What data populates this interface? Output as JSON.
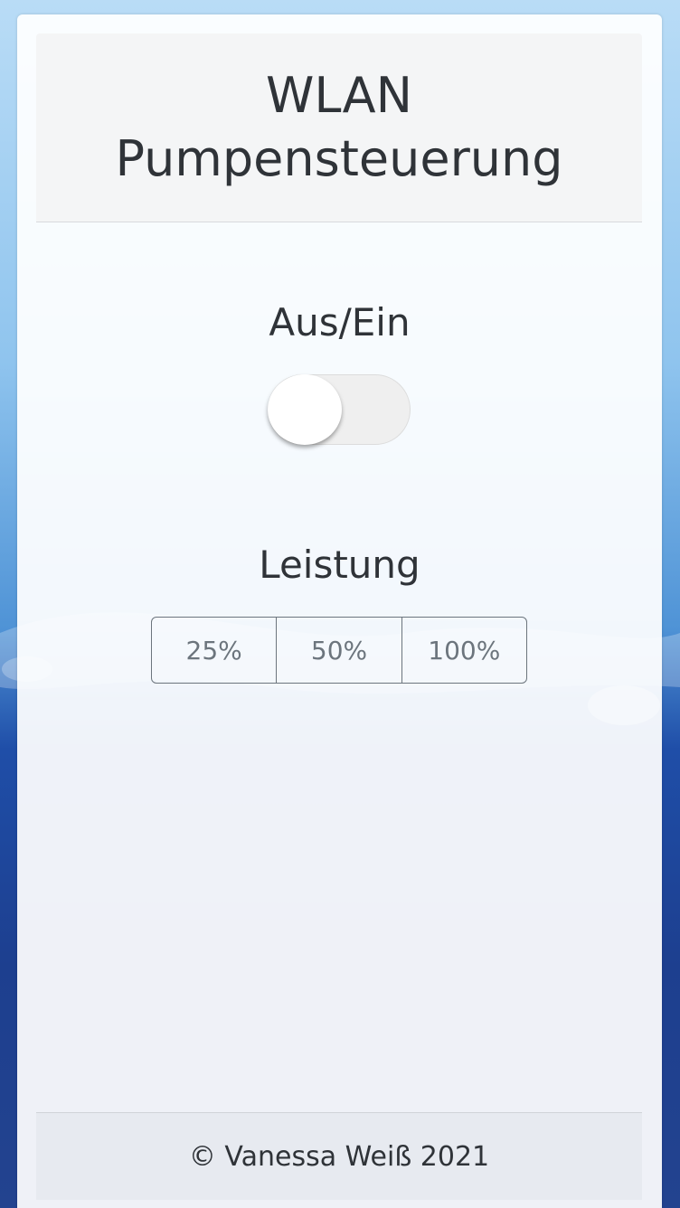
{
  "header": {
    "title": "WLAN Pumpensteuerung"
  },
  "power_switch": {
    "label": "Aus/Ein",
    "checked": false
  },
  "power_level": {
    "label": "Leistung",
    "options": [
      "25%",
      "50%",
      "100%"
    ]
  },
  "footer": {
    "text": "© Vanessa Weiß 2021"
  },
  "colors": {
    "background_top": "#b9dcf6",
    "background_bottom": "#23438f",
    "text": "#2f3338",
    "button_border": "#6c757d"
  }
}
